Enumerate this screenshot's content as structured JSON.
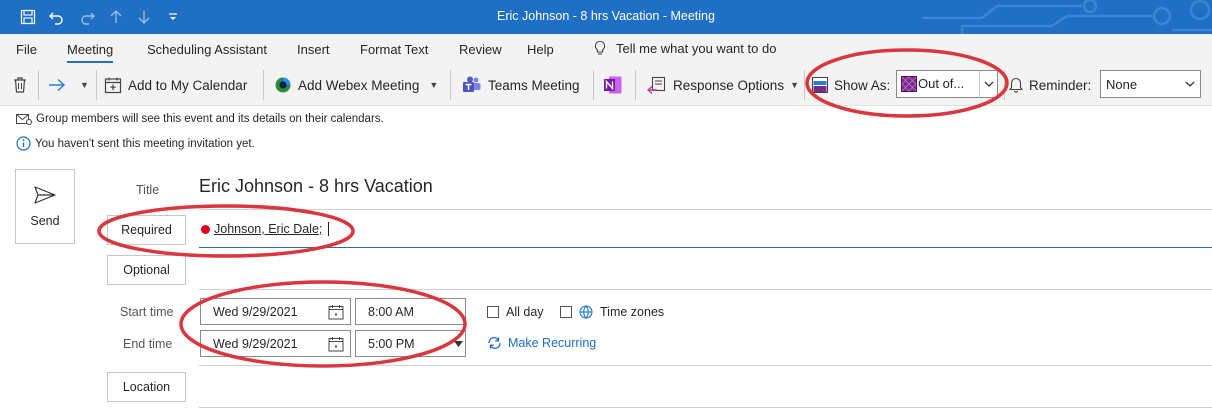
{
  "window": {
    "title": "Eric Johnson - 8 hrs Vacation  -  Meeting"
  },
  "quick_access": {
    "icons": [
      "save-icon",
      "undo-icon",
      "redo-icon",
      "up-arrow-icon",
      "down-arrow-icon",
      "customize-icon"
    ]
  },
  "menu": {
    "file": "File",
    "meeting": "Meeting",
    "scheduling": "Scheduling Assistant",
    "insert": "Insert",
    "format_text": "Format Text",
    "review": "Review",
    "help": "Help",
    "tell_me": "Tell me what you want to do"
  },
  "ribbon": {
    "add_calendar": "Add to My Calendar",
    "add_webex": "Add Webex Meeting",
    "teams": "Teams Meeting",
    "response_options": "Response Options",
    "show_as_label": "Show As:",
    "show_as_value": "Out of...",
    "reminder_label": "Reminder:",
    "reminder_value": "None"
  },
  "info": {
    "group_note": "Group members will see this event and its details on their calendars.",
    "not_sent": "You haven't sent this meeting invitation yet."
  },
  "form": {
    "send": "Send",
    "title_label": "Title",
    "title_value": "Eric Johnson - 8 hrs Vacation",
    "required_btn": "Required",
    "attendee": "Johnson, Eric Dale;",
    "optional_btn": "Optional",
    "start_label": "Start time",
    "start_date": "Wed 9/29/2021",
    "start_time": "8:00 AM",
    "end_label": "End time",
    "end_date": "Wed 9/29/2021",
    "end_time": "5:00 PM",
    "all_day": "All day",
    "time_zones": "Time zones",
    "make_recurring": "Make Recurring",
    "location_btn": "Location"
  },
  "colors": {
    "titlebar": "#1f6fc5",
    "annotation": "#d9363e",
    "link": "#1c6ec9",
    "attendee_status": "#e3001b",
    "out_of_office": "#7a2a8a"
  }
}
